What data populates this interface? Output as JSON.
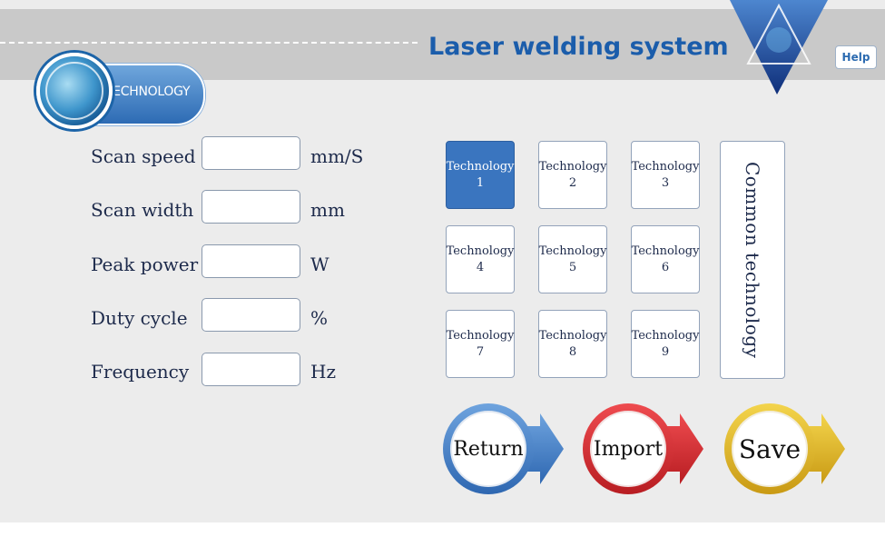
{
  "header": {
    "title": "Laser welding system",
    "help_label": "Help"
  },
  "section": {
    "label": "TECHNOLOGY"
  },
  "params": [
    {
      "label": "Scan speed",
      "value": "",
      "unit": "mm/S"
    },
    {
      "label": "Scan width",
      "value": "",
      "unit": "mm"
    },
    {
      "label": "Peak power",
      "value": "",
      "unit": "W"
    },
    {
      "label": "Duty cycle",
      "value": "",
      "unit": "%"
    },
    {
      "label": "Frequency",
      "value": "",
      "unit": "Hz"
    }
  ],
  "technologies": [
    {
      "label": "Technology",
      "number": "1",
      "active": true
    },
    {
      "label": "Technology",
      "number": "2",
      "active": false
    },
    {
      "label": "Technology",
      "number": "3",
      "active": false
    },
    {
      "label": "Technology",
      "number": "4",
      "active": false
    },
    {
      "label": "Technology",
      "number": "5",
      "active": false
    },
    {
      "label": "Technology",
      "number": "6",
      "active": false
    },
    {
      "label": "Technology",
      "number": "7",
      "active": false
    },
    {
      "label": "Technology",
      "number": "8",
      "active": false
    },
    {
      "label": "Technology",
      "number": "9",
      "active": false
    }
  ],
  "common": {
    "label": "Common technology"
  },
  "actions": {
    "return_label": "Return",
    "import_label": "Import",
    "save_label": "Save"
  },
  "colors": {
    "title": "#1b5dab",
    "active_tech": "#3a75bf",
    "return_accent": "#3f7fc6",
    "import_accent": "#d7262d",
    "save_accent": "#e2b829",
    "header_bg": "#c9c9c9",
    "screen_bg": "#ececec"
  },
  "icons": [
    "logo-triangle-icon",
    "globe-icon",
    "return-arrow-icon",
    "import-arrow-icon",
    "save-arrow-icon"
  ]
}
